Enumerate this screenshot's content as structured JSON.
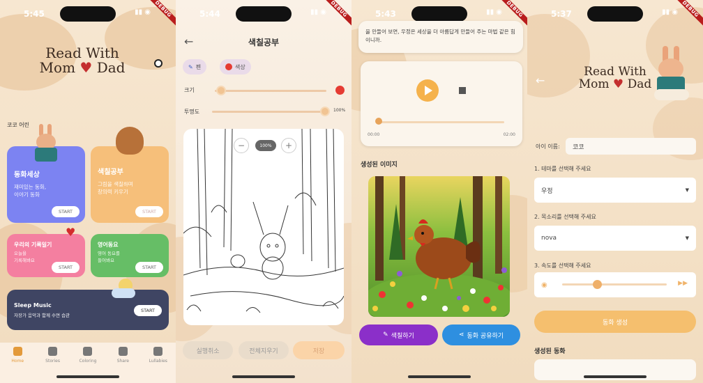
{
  "status": {
    "s1": "5:45",
    "s2": "5:44",
    "s3": "5:43",
    "s4": "5:37",
    "debug": "DEBUG"
  },
  "home": {
    "logo_line1": "Read With",
    "logo_line2a": "Mom",
    "logo_line2b": "Dad",
    "greeting": "코코 어린",
    "cards": [
      {
        "title": "동화세상",
        "desc": "재미있는 동화,\n이야기 동화",
        "start": "START",
        "color": "#7c83f2"
      },
      {
        "title": "색칠공부",
        "desc": "그림을 색칠하며\n창의력 키우기",
        "start": "START",
        "color": "#f6bf7a"
      },
      {
        "title": "우리의 기록일기",
        "desc": "오늘을\n기록해봐요",
        "start": "START",
        "color": "#f47fa0"
      },
      {
        "title": "영어동요",
        "desc": "영어 동요를\n들어봐요",
        "start": "START",
        "color": "#66be66"
      }
    ],
    "sleep": {
      "title": "Sleep Music",
      "desc": "자장가 음악과 함께 수면 습관",
      "start": "START"
    },
    "nav": [
      "Home",
      "Stories",
      "Coloring",
      "Share",
      "Lullabies"
    ]
  },
  "coloring": {
    "title": "색칠공부",
    "chip_pen": "펜",
    "chip_color": "색상",
    "size_label": "크기",
    "opacity_label": "투명도",
    "opacity_value": "100%",
    "zoom_value": "100%",
    "zoom_minus": "−",
    "zoom_plus": "+",
    "undo": "실행취소",
    "clear": "전체지우기",
    "save": "저장",
    "brush_color": "#e53b32"
  },
  "story": {
    "text": "을 만들어 보면, 우정은 세상을 더 아름답게 만들어 주는 마법 같은 힘이니까.",
    "time_start": "00:00",
    "time_end": "02:00",
    "generated_label": "생성된 이미지",
    "color_btn": "색칠하기",
    "share_btn": "동화 공유하기"
  },
  "create": {
    "logo_line1": "Read With",
    "logo_line2a": "Mom",
    "logo_line2b": "Dad",
    "child_label": "아이 이름:",
    "child_value": "코코",
    "theme_label": "1. 테마를 선택해 주세요",
    "theme_value": "우정",
    "voice_label": "2. 목소리를 선택해 주세요",
    "voice_value": "nova",
    "speed_label": "3. 속도를 선택해 주세요",
    "generate_btn": "동화 생성",
    "result_label": "생성된 동화"
  }
}
